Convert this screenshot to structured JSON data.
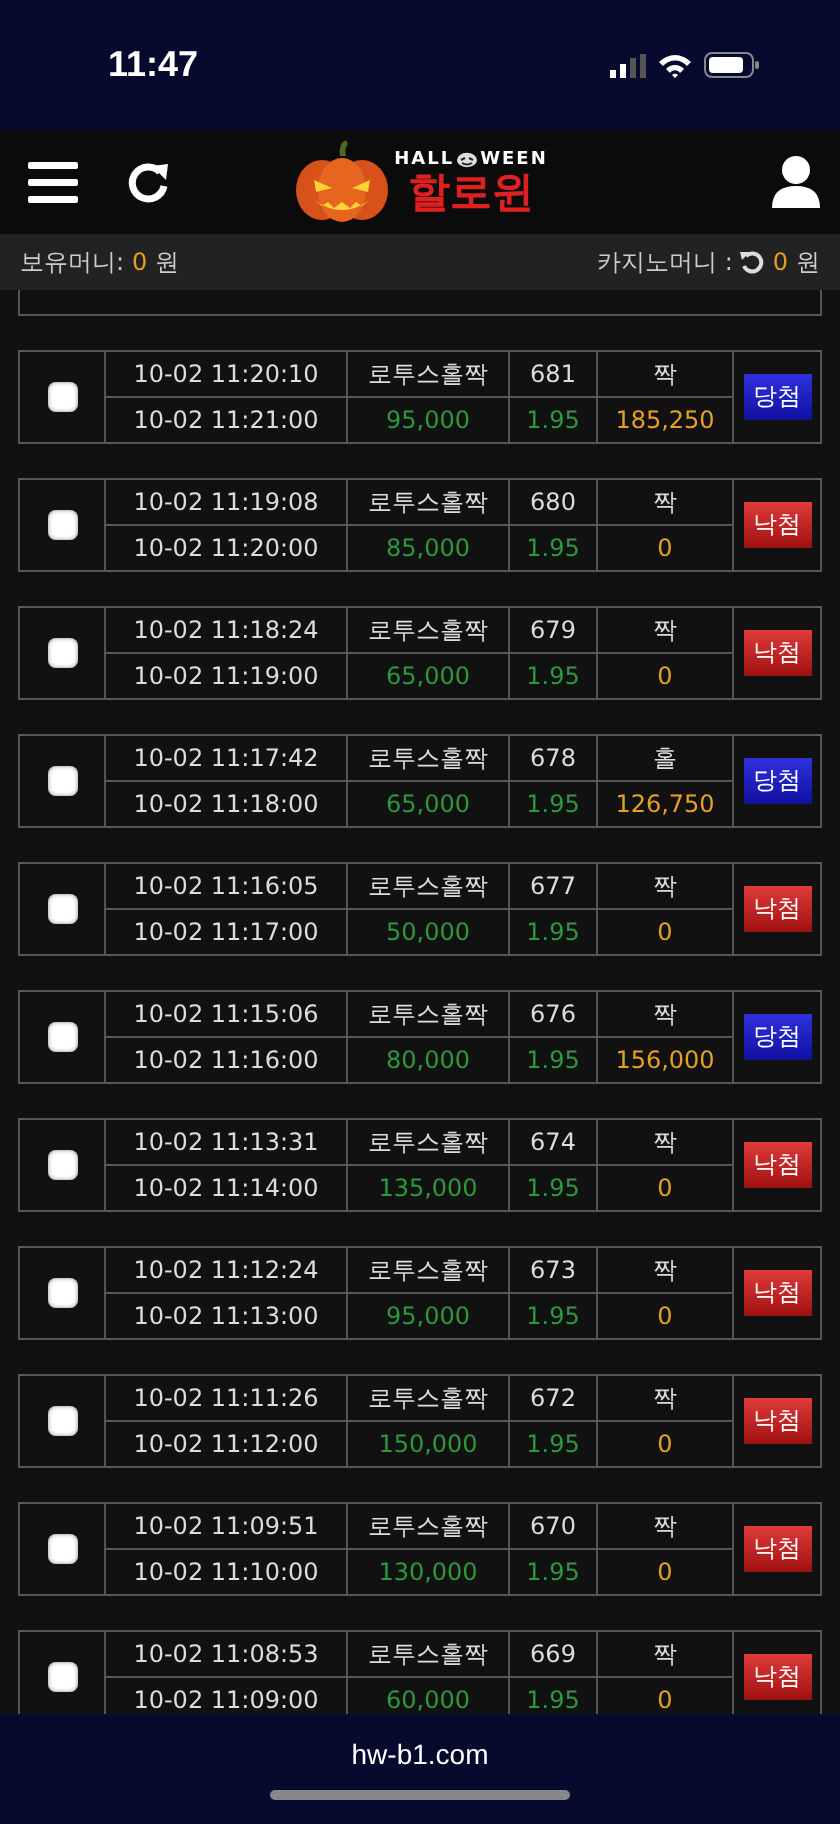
{
  "status_bar": {
    "time": "11:47"
  },
  "header": {
    "logo_top_left": "HALL",
    "logo_top_right": "WEEN",
    "logo_title": "할로윈"
  },
  "balance": {
    "holding_label": "보유머니:",
    "holding_amount": "0",
    "holding_unit": "원",
    "casino_label": "카지노머니 :",
    "casino_amount": "0",
    "casino_unit": "원"
  },
  "bets": [
    {
      "checked": false,
      "bet_time": "10-02 11:20:10",
      "game": "로투스홀짝",
      "round": "681",
      "pick": "짝",
      "draw_time": "10-02 11:21:00",
      "amount": "95,000",
      "odds": "1.95",
      "payout": "185,250",
      "result": "당첨",
      "kind": "win"
    },
    {
      "checked": false,
      "bet_time": "10-02 11:19:08",
      "game": "로투스홀짝",
      "round": "680",
      "pick": "짝",
      "draw_time": "10-02 11:20:00",
      "amount": "85,000",
      "odds": "1.95",
      "payout": "0",
      "result": "낙첨",
      "kind": "lose"
    },
    {
      "checked": false,
      "bet_time": "10-02 11:18:24",
      "game": "로투스홀짝",
      "round": "679",
      "pick": "짝",
      "draw_time": "10-02 11:19:00",
      "amount": "65,000",
      "odds": "1.95",
      "payout": "0",
      "result": "낙첨",
      "kind": "lose"
    },
    {
      "checked": false,
      "bet_time": "10-02 11:17:42",
      "game": "로투스홀짝",
      "round": "678",
      "pick": "홀",
      "draw_time": "10-02 11:18:00",
      "amount": "65,000",
      "odds": "1.95",
      "payout": "126,750",
      "result": "당첨",
      "kind": "win"
    },
    {
      "checked": false,
      "bet_time": "10-02 11:16:05",
      "game": "로투스홀짝",
      "round": "677",
      "pick": "짝",
      "draw_time": "10-02 11:17:00",
      "amount": "50,000",
      "odds": "1.95",
      "payout": "0",
      "result": "낙첨",
      "kind": "lose"
    },
    {
      "checked": false,
      "bet_time": "10-02 11:15:06",
      "game": "로투스홀짝",
      "round": "676",
      "pick": "짝",
      "draw_time": "10-02 11:16:00",
      "amount": "80,000",
      "odds": "1.95",
      "payout": "156,000",
      "result": "당첨",
      "kind": "win"
    },
    {
      "checked": false,
      "bet_time": "10-02 11:13:31",
      "game": "로투스홀짝",
      "round": "674",
      "pick": "짝",
      "draw_time": "10-02 11:14:00",
      "amount": "135,000",
      "odds": "1.95",
      "payout": "0",
      "result": "낙첨",
      "kind": "lose"
    },
    {
      "checked": false,
      "bet_time": "10-02 11:12:24",
      "game": "로투스홀짝",
      "round": "673",
      "pick": "짝",
      "draw_time": "10-02 11:13:00",
      "amount": "95,000",
      "odds": "1.95",
      "payout": "0",
      "result": "낙첨",
      "kind": "lose"
    },
    {
      "checked": false,
      "bet_time": "10-02 11:11:26",
      "game": "로투스홀짝",
      "round": "672",
      "pick": "짝",
      "draw_time": "10-02 11:12:00",
      "amount": "150,000",
      "odds": "1.95",
      "payout": "0",
      "result": "낙첨",
      "kind": "lose"
    },
    {
      "checked": false,
      "bet_time": "10-02 11:09:51",
      "game": "로투스홀짝",
      "round": "670",
      "pick": "짝",
      "draw_time": "10-02 11:10:00",
      "amount": "130,000",
      "odds": "1.95",
      "payout": "0",
      "result": "낙첨",
      "kind": "lose"
    },
    {
      "checked": false,
      "bet_time": "10-02 11:08:53",
      "game": "로투스홀짝",
      "round": "669",
      "pick": "짝",
      "draw_time": "10-02 11:09:00",
      "amount": "60,000",
      "odds": "1.95",
      "payout": "0",
      "result": "낙첨",
      "kind": "lose"
    }
  ],
  "browser_bar": {
    "url": "hw-b1.com"
  }
}
